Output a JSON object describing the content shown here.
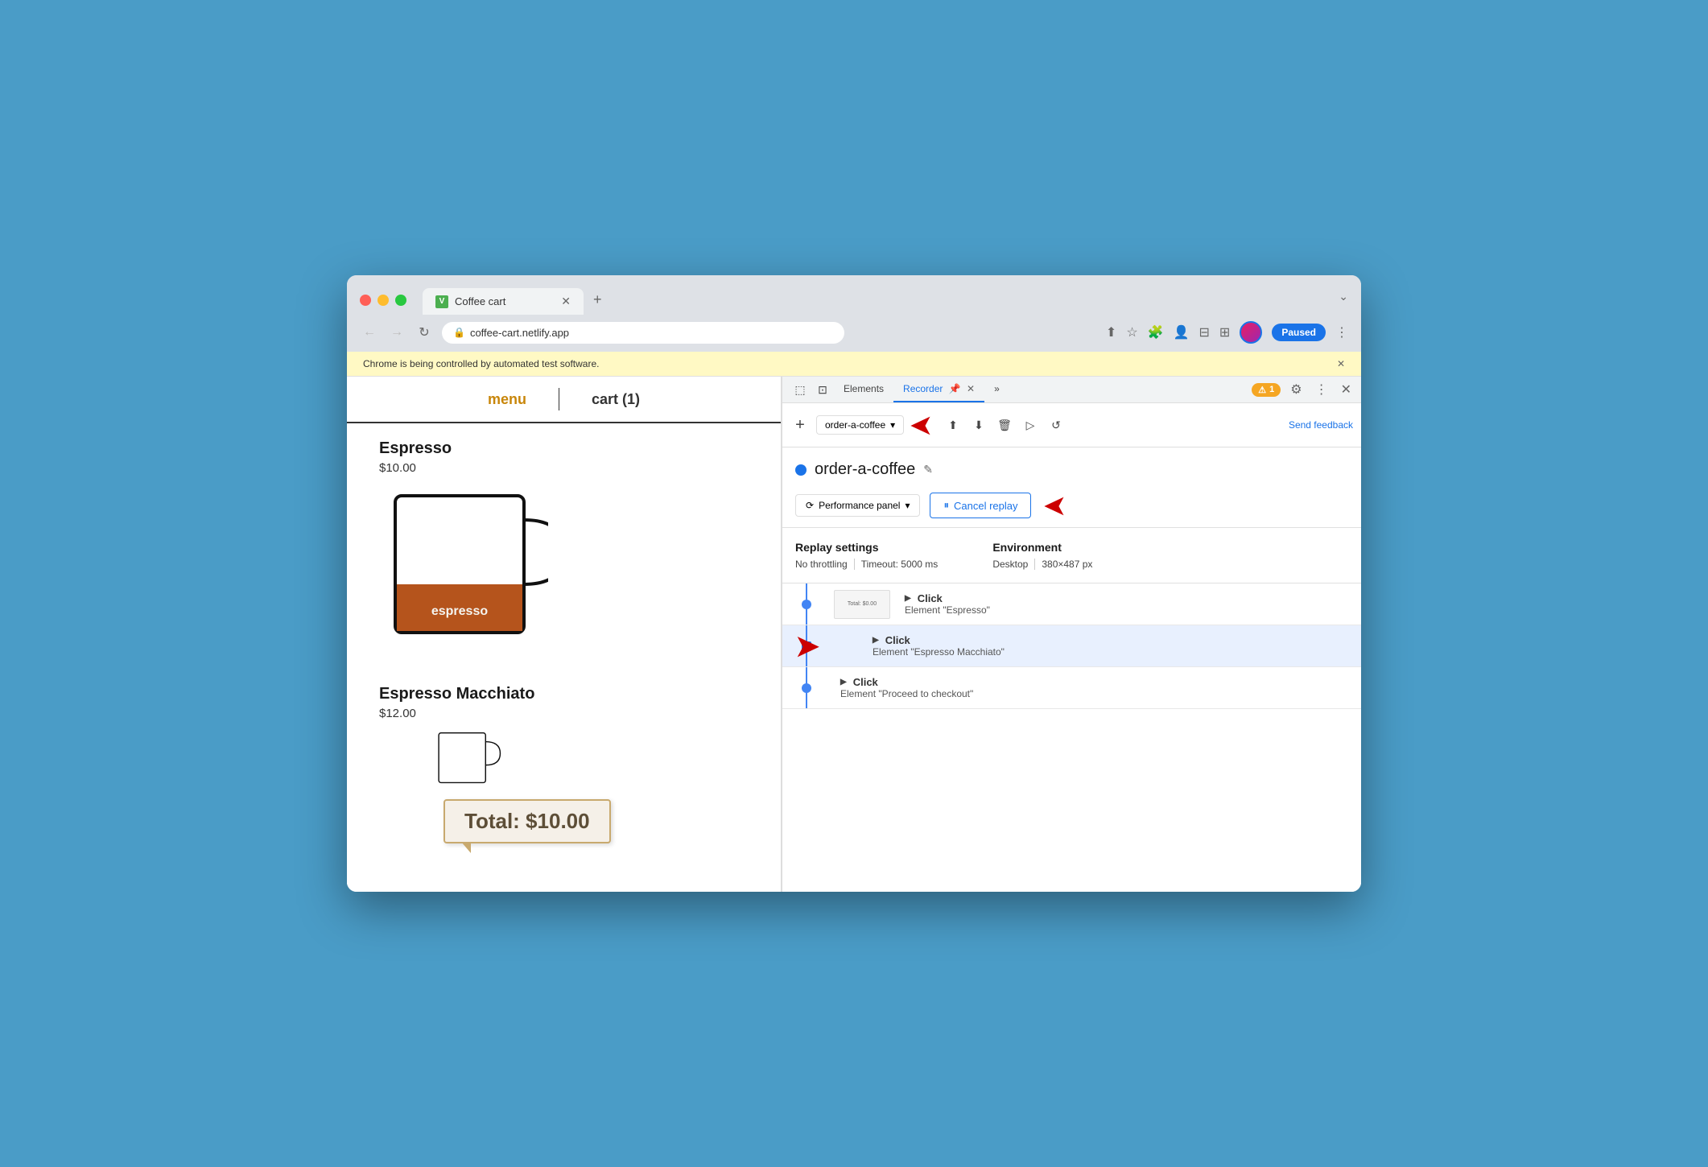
{
  "browser": {
    "tab_title": "Coffee cart",
    "tab_favicon": "V",
    "url": "coffee-cart.netlify.app",
    "paused_label": "Paused",
    "automation_message": "Chrome is being controlled by automated test software."
  },
  "nav": {
    "menu_label": "menu",
    "cart_label": "cart (1)"
  },
  "products": [
    {
      "name": "Espresso",
      "price": "$10.00",
      "label": "espresso"
    },
    {
      "name": "Espresso Macchiato",
      "price": "$12.00"
    }
  ],
  "total": "Total: $10.00",
  "devtools": {
    "tabs": [
      "Elements",
      "Recorder",
      "»"
    ],
    "recorder_tab": "Recorder",
    "notification_count": "1",
    "send_feedback": "Send feedback",
    "recording_name": "order-a-coffee",
    "add_btn": "+",
    "performance_panel": "Performance panel",
    "cancel_replay": "Cancel replay",
    "replay_settings": {
      "label": "Replay settings",
      "no_throttling": "No throttling",
      "timeout": "Timeout: 5000 ms"
    },
    "environment": {
      "label": "Environment",
      "desktop": "Desktop",
      "size": "380×487 px"
    },
    "steps": [
      {
        "action": "Click",
        "detail": "Element \"Espresso\"",
        "has_preview": true,
        "preview_label": "Total: $0.00"
      },
      {
        "action": "Click",
        "detail": "Element \"Espresso Macchiato\"",
        "active": true,
        "has_arrow": true
      },
      {
        "action": "Click",
        "detail": "Element \"Proceed to checkout\""
      }
    ]
  }
}
